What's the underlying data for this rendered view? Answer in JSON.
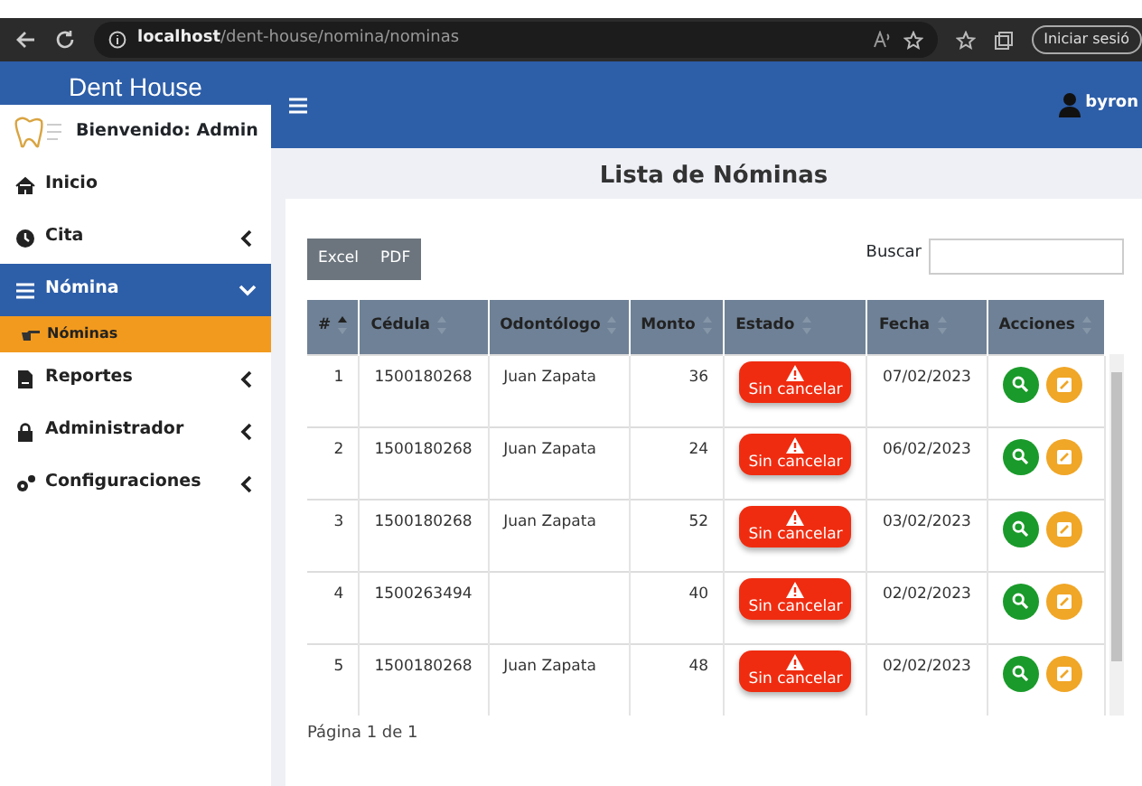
{
  "browser": {
    "url": "**localhost**/dent-house/nomina/nominas",
    "sign_in_button": "Iniciar sesió"
  },
  "brand": "Dent House",
  "user": {
    "name": "byron"
  },
  "sidebar": {
    "welcome": "Bienvenido: Admin",
    "items": [
      {
        "label": "Inicio",
        "kind": "link",
        "selected": false
      },
      {
        "label": "Cita",
        "kind": "group",
        "expanded": false,
        "selected": false
      },
      {
        "label": "Nómina",
        "kind": "group",
        "expanded": true,
        "selected": true,
        "children": [
          {
            "label": "Nóminas",
            "selected": true
          }
        ]
      },
      {
        "label": "Reportes",
        "kind": "group",
        "expanded": false,
        "selected": false
      },
      {
        "label": "Administrador",
        "kind": "group",
        "expanded": false,
        "selected": false
      },
      {
        "label": "Configuraciones",
        "kind": "group",
        "expanded": false,
        "selected": false
      }
    ]
  },
  "page_title": "Lista de Nóminas",
  "export_buttons": [
    "Excel",
    "PDF"
  ],
  "search": {
    "label": "Buscar"
  },
  "table": {
    "columns": [
      {
        "label": "#",
        "sorted": true
      },
      {
        "label": "Cédula",
        "sorted": false
      },
      {
        "label": "Odontólogo",
        "sorted": false
      },
      {
        "label": "Monto",
        "sorted": false
      },
      {
        "label": "Estado",
        "sorted": false
      },
      {
        "label": "Fecha",
        "sorted": false
      },
      {
        "label": "Acciones",
        "sorted": false
      }
    ],
    "rows": [
      {
        "n": "1",
        "cedula": "1500180268",
        "odontologo": "Juan Zapata",
        "monto": "36",
        "estado": "Sin cancelar",
        "fecha": "07/02/2023"
      },
      {
        "n": "2",
        "cedula": "1500180268",
        "odontologo": "Juan Zapata",
        "monto": "24",
        "estado": "Sin cancelar",
        "fecha": "06/02/2023"
      },
      {
        "n": "3",
        "cedula": "1500180268",
        "odontologo": "Juan Zapata",
        "monto": "52",
        "estado": "Sin cancelar",
        "fecha": "03/02/2023"
      },
      {
        "n": "4",
        "cedula": "1500263494",
        "monto": "40",
        "estado": "Sin cancelar",
        "fecha": "02/02/2023"
      },
      {
        "n": "5",
        "cedula": "1500180268",
        "odontologo": "Juan Zapata",
        "monto": "48",
        "estado": "Sin cancelar",
        "fecha": "02/02/2023"
      }
    ]
  },
  "pagination": "Página 1 de 1"
}
